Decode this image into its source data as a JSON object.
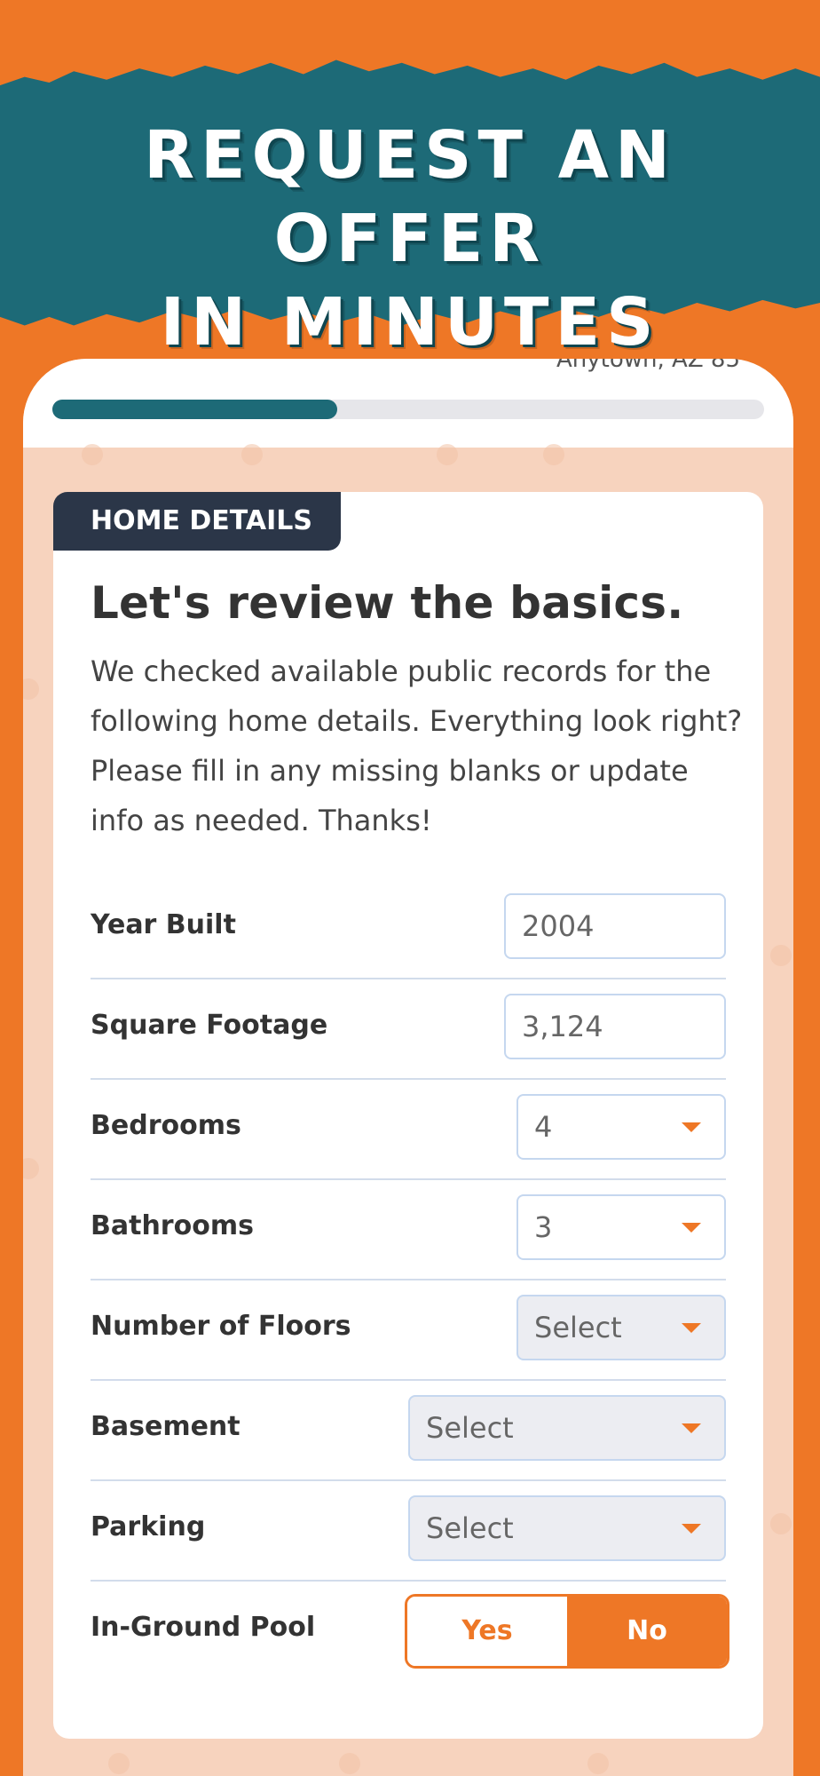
{
  "banner": {
    "title_line1": "Request an offer",
    "title_line2": "in minutes"
  },
  "card_header": {
    "address_partial": "Anytown, AZ 85"
  },
  "progress": {
    "fraction": 0.4
  },
  "form": {
    "section_tag": "HOME DETAILS",
    "heading": "Let's review the basics.",
    "intro": "We checked available public records for the following home details. Everything look right? Please fill in any missing blanks or update info as needed. Thanks!",
    "fields": {
      "year_built": {
        "label": "Year Built",
        "value": "2004"
      },
      "square_footage": {
        "label": "Square Footage",
        "value": "3,124"
      },
      "bedrooms": {
        "label": "Bedrooms",
        "value": "4"
      },
      "bathrooms": {
        "label": "Bathrooms",
        "value": "3"
      },
      "floors": {
        "label": "Number of Floors",
        "value": "Select"
      },
      "basement": {
        "label": "Basement",
        "value": "Select"
      },
      "parking": {
        "label": "Parking",
        "value": "Select"
      },
      "pool": {
        "label": "In-Ground Pool",
        "yes_label": "Yes",
        "no_label": "No",
        "selected": "No"
      }
    }
  },
  "colors": {
    "brand_orange": "#EE7726",
    "banner_teal": "#1D6A77",
    "tag_navy": "#2B3648"
  }
}
